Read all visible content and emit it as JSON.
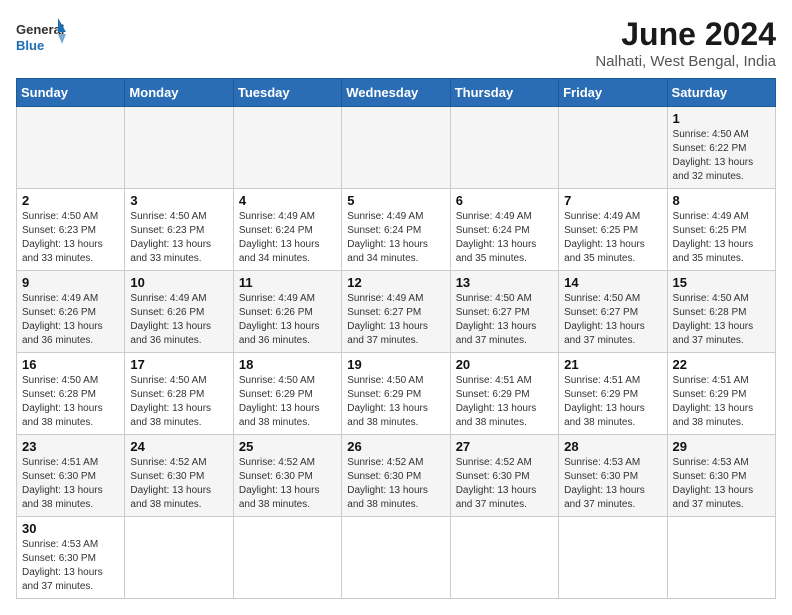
{
  "logo": {
    "text_general": "General",
    "text_blue": "Blue"
  },
  "title": "June 2024",
  "location": "Nalhati, West Bengal, India",
  "days_of_week": [
    "Sunday",
    "Monday",
    "Tuesday",
    "Wednesday",
    "Thursday",
    "Friday",
    "Saturday"
  ],
  "weeks": [
    [
      {
        "day": "",
        "content": ""
      },
      {
        "day": "",
        "content": ""
      },
      {
        "day": "",
        "content": ""
      },
      {
        "day": "",
        "content": ""
      },
      {
        "day": "",
        "content": ""
      },
      {
        "day": "",
        "content": ""
      },
      {
        "day": "1",
        "content": "Sunrise: 4:50 AM\nSunset: 6:22 PM\nDaylight: 13 hours and 32 minutes."
      }
    ],
    [
      {
        "day": "2",
        "content": "Sunrise: 4:50 AM\nSunset: 6:23 PM\nDaylight: 13 hours and 33 minutes."
      },
      {
        "day": "3",
        "content": "Sunrise: 4:50 AM\nSunset: 6:23 PM\nDaylight: 13 hours and 33 minutes."
      },
      {
        "day": "4",
        "content": "Sunrise: 4:49 AM\nSunset: 6:24 PM\nDaylight: 13 hours and 34 minutes."
      },
      {
        "day": "5",
        "content": "Sunrise: 4:49 AM\nSunset: 6:24 PM\nDaylight: 13 hours and 34 minutes."
      },
      {
        "day": "6",
        "content": "Sunrise: 4:49 AM\nSunset: 6:24 PM\nDaylight: 13 hours and 35 minutes."
      },
      {
        "day": "7",
        "content": "Sunrise: 4:49 AM\nSunset: 6:25 PM\nDaylight: 13 hours and 35 minutes."
      },
      {
        "day": "8",
        "content": "Sunrise: 4:49 AM\nSunset: 6:25 PM\nDaylight: 13 hours and 35 minutes."
      }
    ],
    [
      {
        "day": "9",
        "content": "Sunrise: 4:49 AM\nSunset: 6:26 PM\nDaylight: 13 hours and 36 minutes."
      },
      {
        "day": "10",
        "content": "Sunrise: 4:49 AM\nSunset: 6:26 PM\nDaylight: 13 hours and 36 minutes."
      },
      {
        "day": "11",
        "content": "Sunrise: 4:49 AM\nSunset: 6:26 PM\nDaylight: 13 hours and 36 minutes."
      },
      {
        "day": "12",
        "content": "Sunrise: 4:49 AM\nSunset: 6:27 PM\nDaylight: 13 hours and 37 minutes."
      },
      {
        "day": "13",
        "content": "Sunrise: 4:50 AM\nSunset: 6:27 PM\nDaylight: 13 hours and 37 minutes."
      },
      {
        "day": "14",
        "content": "Sunrise: 4:50 AM\nSunset: 6:27 PM\nDaylight: 13 hours and 37 minutes."
      },
      {
        "day": "15",
        "content": "Sunrise: 4:50 AM\nSunset: 6:28 PM\nDaylight: 13 hours and 37 minutes."
      }
    ],
    [
      {
        "day": "16",
        "content": "Sunrise: 4:50 AM\nSunset: 6:28 PM\nDaylight: 13 hours and 38 minutes."
      },
      {
        "day": "17",
        "content": "Sunrise: 4:50 AM\nSunset: 6:28 PM\nDaylight: 13 hours and 38 minutes."
      },
      {
        "day": "18",
        "content": "Sunrise: 4:50 AM\nSunset: 6:29 PM\nDaylight: 13 hours and 38 minutes."
      },
      {
        "day": "19",
        "content": "Sunrise: 4:50 AM\nSunset: 6:29 PM\nDaylight: 13 hours and 38 minutes."
      },
      {
        "day": "20",
        "content": "Sunrise: 4:51 AM\nSunset: 6:29 PM\nDaylight: 13 hours and 38 minutes."
      },
      {
        "day": "21",
        "content": "Sunrise: 4:51 AM\nSunset: 6:29 PM\nDaylight: 13 hours and 38 minutes."
      },
      {
        "day": "22",
        "content": "Sunrise: 4:51 AM\nSunset: 6:29 PM\nDaylight: 13 hours and 38 minutes."
      }
    ],
    [
      {
        "day": "23",
        "content": "Sunrise: 4:51 AM\nSunset: 6:30 PM\nDaylight: 13 hours and 38 minutes."
      },
      {
        "day": "24",
        "content": "Sunrise: 4:52 AM\nSunset: 6:30 PM\nDaylight: 13 hours and 38 minutes."
      },
      {
        "day": "25",
        "content": "Sunrise: 4:52 AM\nSunset: 6:30 PM\nDaylight: 13 hours and 38 minutes."
      },
      {
        "day": "26",
        "content": "Sunrise: 4:52 AM\nSunset: 6:30 PM\nDaylight: 13 hours and 38 minutes."
      },
      {
        "day": "27",
        "content": "Sunrise: 4:52 AM\nSunset: 6:30 PM\nDaylight: 13 hours and 37 minutes."
      },
      {
        "day": "28",
        "content": "Sunrise: 4:53 AM\nSunset: 6:30 PM\nDaylight: 13 hours and 37 minutes."
      },
      {
        "day": "29",
        "content": "Sunrise: 4:53 AM\nSunset: 6:30 PM\nDaylight: 13 hours and 37 minutes."
      }
    ],
    [
      {
        "day": "30",
        "content": "Sunrise: 4:53 AM\nSunset: 6:30 PM\nDaylight: 13 hours and 37 minutes."
      },
      {
        "day": "",
        "content": ""
      },
      {
        "day": "",
        "content": ""
      },
      {
        "day": "",
        "content": ""
      },
      {
        "day": "",
        "content": ""
      },
      {
        "day": "",
        "content": ""
      },
      {
        "day": "",
        "content": ""
      }
    ]
  ]
}
